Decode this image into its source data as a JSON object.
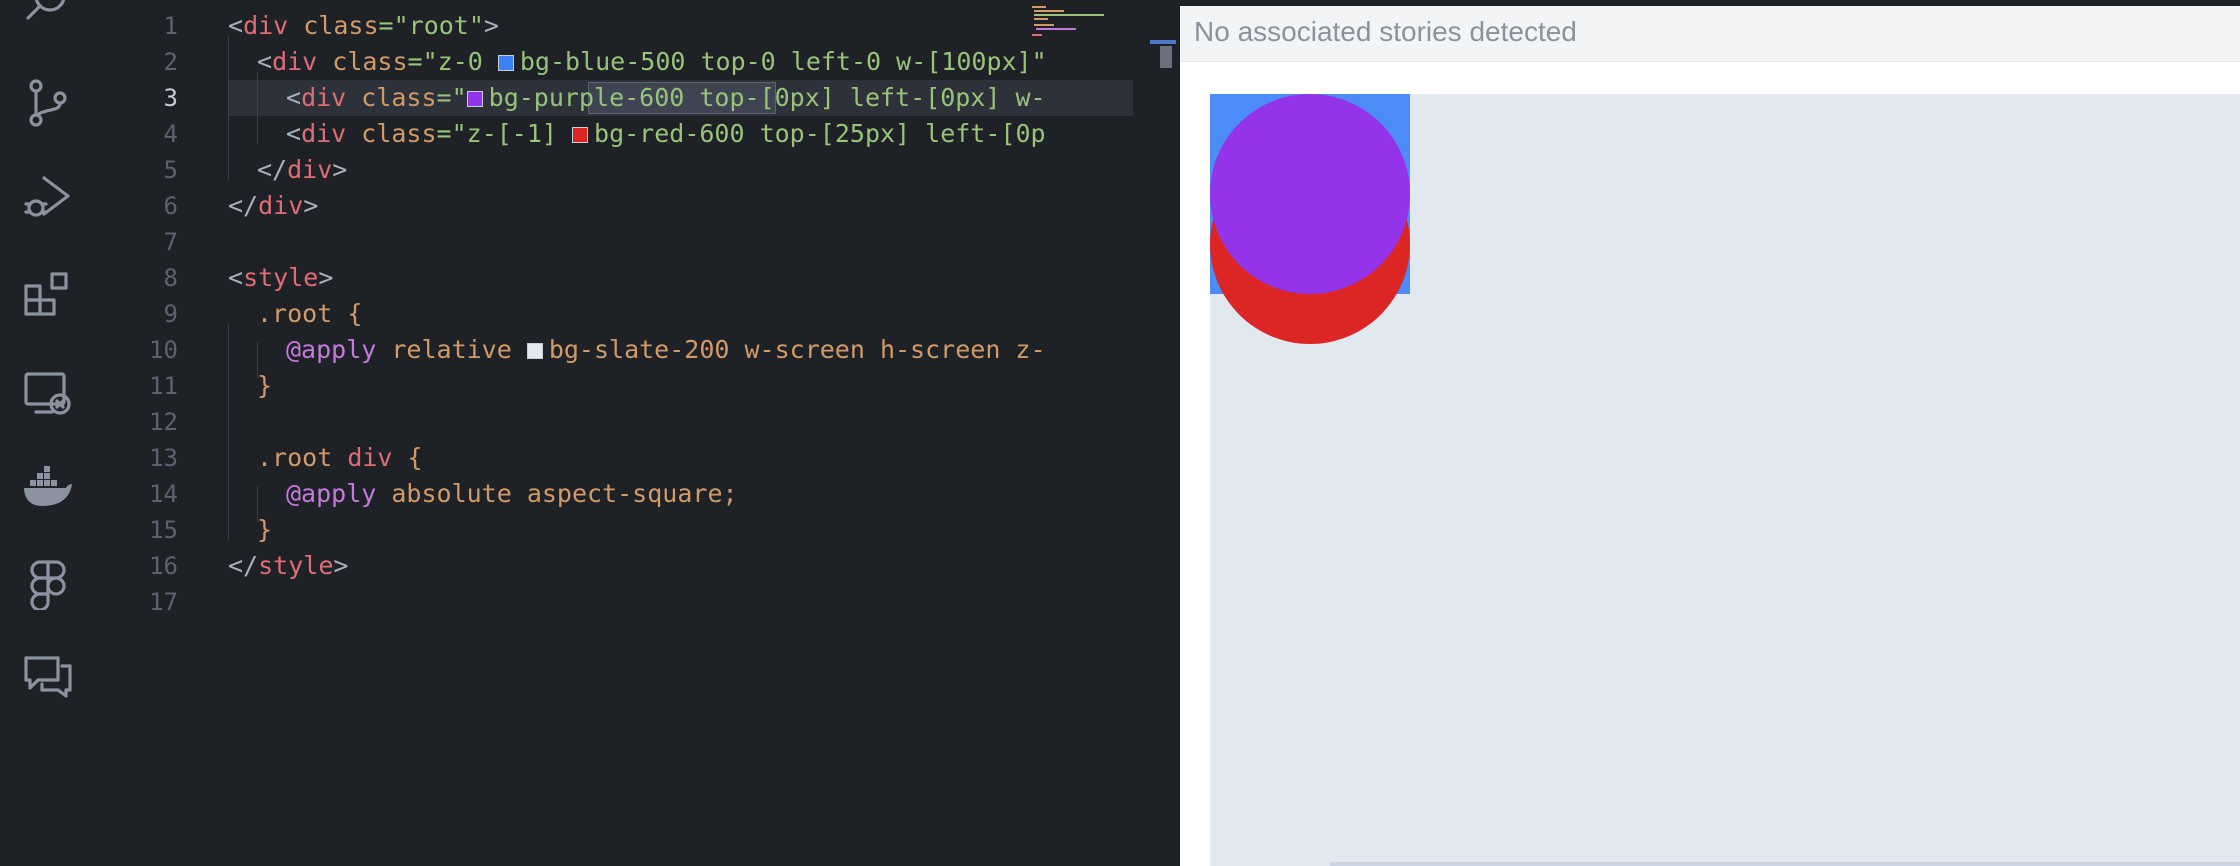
{
  "activity_bar": {
    "icons": [
      "search-icon",
      "source-control-icon",
      "run-debug-icon",
      "extensions-icon",
      "remote-explorer-icon",
      "docker-icon",
      "figma-icon",
      "comments-icon"
    ]
  },
  "editor": {
    "line_numbers": [
      "1",
      "2",
      "3",
      "4",
      "5",
      "6",
      "7",
      "8",
      "9",
      "10",
      "11",
      "12",
      "13",
      "14",
      "15",
      "16",
      "17"
    ],
    "active_line": "3",
    "lines": {
      "l1": [
        "<",
        "div",
        " ",
        "class",
        "=\"root\"",
        ">"
      ],
      "l2": [
        "<",
        "div",
        " ",
        "class",
        "=\"z-0 ",
        "bg-blue-500 top-0 left-0 w-[100px]\""
      ],
      "l3": [
        "<",
        "div",
        " ",
        "class",
        "=\"",
        "bg-purple-600",
        " top-[0px] left-[0px] w-"
      ],
      "l4": [
        "<",
        "div",
        " ",
        "class",
        "=\"z-[-1] ",
        "bg-red-600 top-[25px] left-[0p"
      ],
      "l5": [
        "</",
        "div",
        ">"
      ],
      "l6": [
        "</",
        "div",
        ">"
      ],
      "l8": [
        "<",
        "style",
        ">"
      ],
      "l9": [
        ".root",
        " {"
      ],
      "l10": [
        "@apply",
        " relative ",
        "bg-slate-200 w-screen h-screen z-"
      ],
      "l11": [
        "}"
      ],
      "l13": [
        ".root ",
        "div",
        " {"
      ],
      "l14": [
        "@apply",
        " absolute aspect-square;"
      ],
      "l15": [
        "}"
      ],
      "l16": [
        "</",
        "style",
        ">"
      ]
    },
    "swatch_colors": {
      "blue": "#3b82f6",
      "purple": "#9333ea",
      "red": "#dc2626",
      "slate": "#e2e8f0"
    }
  },
  "preview": {
    "title": "No associated stories detected",
    "colors": {
      "stage": "#e2e8f0",
      "blue": "#3b82f6",
      "purple": "#9333ea",
      "red": "#dc2626"
    }
  }
}
